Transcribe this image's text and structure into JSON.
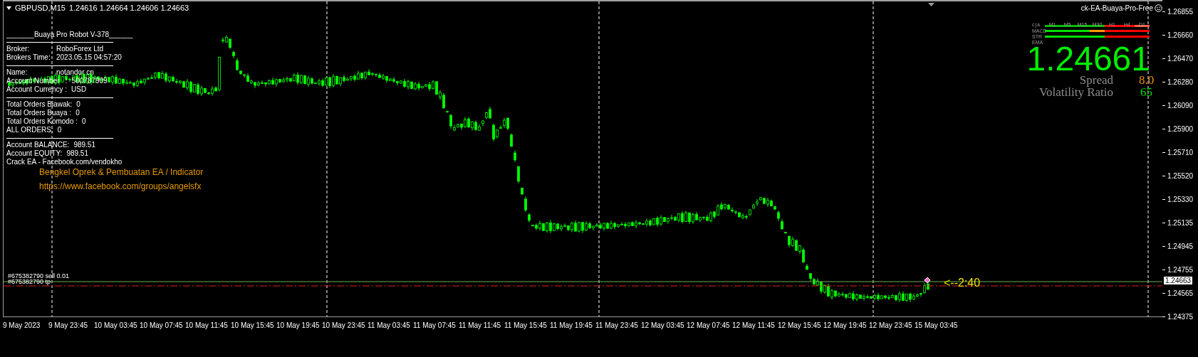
{
  "chart_header": {
    "symbol": "GBPUSD,M15",
    "ohlc": "1.24616 1.24664 1.24606 1.24663"
  },
  "ea_panel": {
    "title": "_______Buaya Pro Robot V-378______",
    "sections": [
      [
        {
          "label": "Broker:",
          "value": "RoboForex Ltd"
        },
        {
          "label": "Brokers Time:",
          "value": "2023.05.15 04:57:20"
        }
      ],
      [
        {
          "label": "Name:",
          "value": "notandor cn"
        },
        {
          "label": "Account Number   :",
          "value": "500787909"
        },
        {
          "label": "Account Currency :",
          "value": "USD"
        }
      ],
      [
        {
          "label": "Total Orders Biawak:",
          "value": "0"
        },
        {
          "label": "Total Orders Buaya :",
          "value": "0"
        },
        {
          "label": "Total Orders Komodo :",
          "value": "0"
        },
        {
          "label": "ALL ORDERS:",
          "value": "0"
        }
      ],
      [
        {
          "label": "Account BALANCE:",
          "value": "989.51"
        },
        {
          "label": "Account EQUITY:",
          "value": "989.51"
        }
      ]
    ],
    "footer": "Crack EA - Facebook.com/vendokho"
  },
  "promo": [
    "Bengkel Oprek & Pembuatan EA / Indicator",
    "https://www.facebook.com/groups/angelsfx"
  ],
  "ea_name": "ck-EA-Buaya-Pro-Free",
  "signal_panel": {
    "header": "cja",
    "timeframes": [
      "M1",
      "M5",
      "M15",
      "M30",
      "H1",
      "H4",
      "D1"
    ],
    "row_labels": [
      "MACD",
      "STR",
      "EMA"
    ],
    "lines": [
      {
        "segments": [
          {
            "color": "#00c000"
          },
          {
            "color": "#00c000"
          },
          {
            "color": "#00c000"
          },
          {
            "color": "#00c000"
          },
          {
            "color": "#ff0000"
          },
          {
            "color": "#ff0000"
          },
          {
            "color": "#ff6040"
          }
        ]
      },
      {
        "segments": [
          {
            "color": "#00e000"
          },
          {
            "color": "#00e000"
          },
          {
            "color": "#00e000"
          },
          {
            "color": "#ff9900"
          },
          {
            "color": "#ff0000"
          },
          {
            "color": "#ff0000"
          },
          {
            "color": "#ff0000"
          }
        ]
      },
      {
        "segments": [
          {
            "color": "#00e000"
          },
          {
            "color": "#00e000"
          },
          {
            "color": "#00e000"
          },
          {
            "color": "#00e000"
          },
          {
            "color": "#ff0000"
          },
          {
            "color": "#ff0000"
          },
          {
            "color": "#ff0000"
          }
        ]
      }
    ]
  },
  "price_display": {
    "bid": "1.24661",
    "spread_label": "Spread",
    "spread": "8.0",
    "volatility_label": "Volatility Ratio",
    "volatility": "65"
  },
  "orders": [
    {
      "label": "#675382790 sell 0.01"
    },
    {
      "label": "#675382790 tp"
    }
  ],
  "countdown": "<--2:40",
  "price_axis": {
    "ticks": [
      "1.26855",
      "1.26660",
      "1.26470",
      "1.26280",
      "1.26090",
      "1.25900",
      "1.25710",
      "1.25520",
      "1.25330",
      "1.25135",
      "1.24945",
      "1.24755",
      "1.24565",
      "1.24375"
    ],
    "current": "1.24663"
  },
  "time_axis": [
    "9 May 2023",
    "9 May 23:45",
    "10 May 03:45",
    "10 May 07:45",
    "10 May 11:45",
    "10 May 15:45",
    "10 May 19:45",
    "10 May 23:45",
    "11 May 03:45",
    "11 May 07:45",
    "11 May 11:45",
    "11 May 15:45",
    "11 May 19:45",
    "11 May 23:45",
    "12 May 03:45",
    "12 May 07:45",
    "12 May 11:45",
    "12 May 15:45",
    "12 May 19:45",
    "12 May 23:45",
    "15 May 03:45"
  ]
}
